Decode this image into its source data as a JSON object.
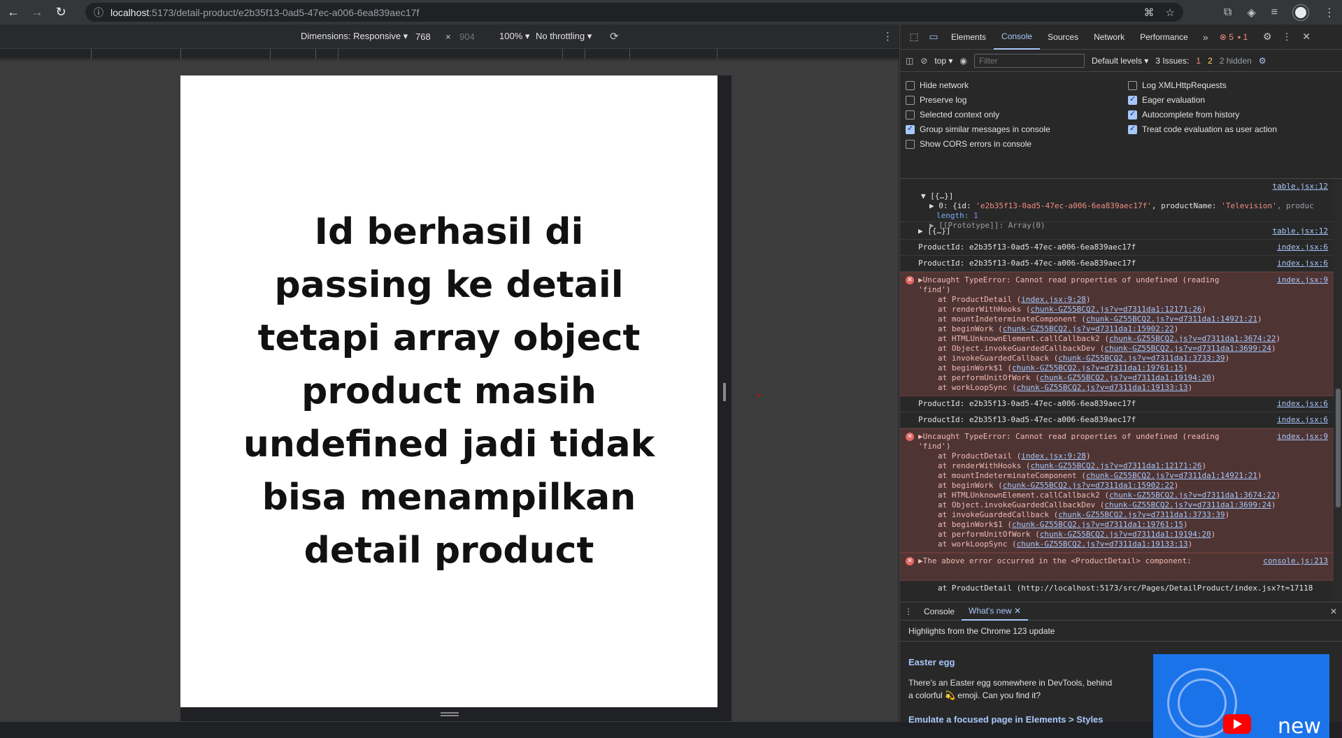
{
  "browser": {
    "url_host": "localhost",
    "url_path": ":5173/detail-product/e2b35f13-0ad5-47ec-a006-6ea839aec17f"
  },
  "device_toolbar": {
    "dimensions_label": "Dimensions: Responsive ▾",
    "width": "768",
    "height": "904",
    "zoom": "100% ▾",
    "throttling": "No throttling ▾"
  },
  "page": {
    "message": "Id berhasil di passing ke detail tetapi array object product masih undefined jadi tidak bisa menampilkan detail product"
  },
  "devtools": {
    "tabs": [
      "Elements",
      "Console",
      "Sources",
      "Network",
      "Performance"
    ],
    "error_count": "5",
    "issue_count": "1",
    "context": "top ▾",
    "filter_placeholder": "Filter",
    "levels": "Default levels ▾",
    "issues_label": "3 Issues:",
    "issues_err": "1",
    "issues_warn": "2",
    "hidden": "2 hidden",
    "settings_left": [
      "Hide network",
      "Preserve log",
      "Selected context only",
      "Group similar messages in console",
      "Show CORS errors in console"
    ],
    "settings_right": [
      "Log XMLHttpRequests",
      "Eager evaluation",
      "Autocomplete from history",
      "Treat code evaluation as user action"
    ],
    "console": {
      "table_src": "table.jsx:12",
      "array_label": "▼ [{…}]",
      "item0_prefix": "▶ 0: {id: ",
      "item0_id": "'e2b35f13-0ad5-47ec-a006-6ea839aec17f'",
      "item0_mid": ", productName: ",
      "item0_name": "'Television'",
      "item0_tail": ", produc",
      "length_key": "length: ",
      "length_val": "1",
      "prototype": "▶ [[Prototype]]: Array(0)",
      "array2_label": "▶ [{…}]",
      "productid_line": "ProductId: e2b35f13-0ad5-47ec-a006-6ea839aec17f",
      "index6": "index.jsx:6",
      "index9": "index.jsx:9",
      "error_head": "▶Uncaught TypeError: Cannot read properties of undefined (reading",
      "error_head2": "'find')",
      "stack": [
        {
          "fn": "at ProductDetail (",
          "link": "index.jsx:9:28",
          "end": ")"
        },
        {
          "fn": "at renderWithHooks (",
          "link": "chunk-GZ55BCQ2.js?v=d7311da1:12171:26",
          "end": ")"
        },
        {
          "fn": "at mountIndeterminateComponent (",
          "link": "chunk-GZ55BCQ2.js?v=d7311da1:14921:21",
          "end": ")"
        },
        {
          "fn": "at beginWork (",
          "link": "chunk-GZ55BCQ2.js?v=d7311da1:15902:22",
          "end": ")"
        },
        {
          "fn": "at HTMLUnknownElement.callCallback2 (",
          "link": "chunk-GZ55BCQ2.js?v=d7311da1:3674:22",
          "end": ")"
        },
        {
          "fn": "at Object.invokeGuardedCallbackDev (",
          "link": "chunk-GZ55BCQ2.js?v=d7311da1:3699:24",
          "end": ")"
        },
        {
          "fn": "at invokeGuardedCallback (",
          "link": "chunk-GZ55BCQ2.js?v=d7311da1:3733:39",
          "end": ")"
        },
        {
          "fn": "at beginWork$1 (",
          "link": "chunk-GZ55BCQ2.js?v=d7311da1:19761:15",
          "end": ")"
        },
        {
          "fn": "at performUnitOfWork (",
          "link": "chunk-GZ55BCQ2.js?v=d7311da1:19194:20",
          "end": ")"
        },
        {
          "fn": "at workLoopSync (",
          "link": "chunk-GZ55BCQ2.js?v=d7311da1:19133:13",
          "end": ")"
        }
      ],
      "above_error": "▶The above error occurred in the <ProductDetail> component:",
      "console_src": "console.js:213",
      "product_detail_at": "at ProductDetail (http://localhost:5173/src/Pages/DetailProduct/index.jsx?t=17118"
    },
    "drawer": {
      "tab_console": "Console",
      "tab_whatsnew": "What's new",
      "highlights": "Highlights from the Chrome 123 update",
      "egg_title": "Easter egg",
      "egg_desc": "There's an Easter egg somewhere in DevTools, behind a colorful 💫 emoji. Can you find it?",
      "emulate_link": "Emulate a focused page in Elements > Styles",
      "img_text": "new"
    }
  }
}
